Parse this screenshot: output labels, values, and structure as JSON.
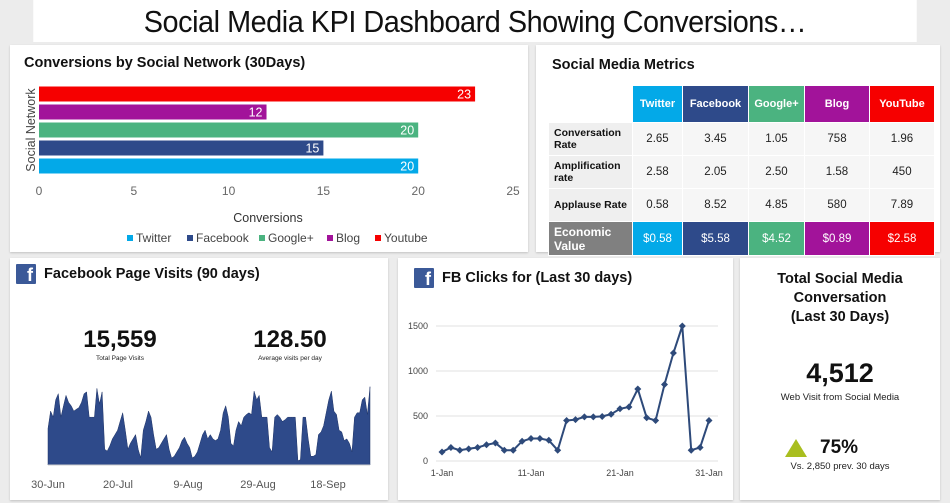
{
  "title": "Social Media KPI Dashboard Showing Conversions…",
  "colors": {
    "twitter": "#03a9e8",
    "facebook": "#2e4a8a",
    "google": "#4bb380",
    "blog": "#a2139a",
    "youtube": "#f60000",
    "fb_brand": "#3b5998",
    "area_fill": "#2e4a8a",
    "line": "#2e4a7a",
    "up_arrow": "#a9be1f",
    "econ_label": "#808080"
  },
  "conversions": {
    "title": "Conversions by Social Network (30Days)",
    "legend": [
      "Twitter",
      "Facebook",
      "Google+",
      "Blog",
      "Youtube"
    ]
  },
  "metrics": {
    "title": "Social Media Metrics",
    "columns": [
      "Twitter",
      "Facebook",
      "Google+",
      "Blog",
      "YouTube"
    ],
    "rows": [
      {
        "label": "Conversation Rate",
        "values": [
          "2.65",
          "3.45",
          "1.05",
          "758",
          "1.96"
        ]
      },
      {
        "label": "Amplification rate",
        "values": [
          "2.58",
          "2.05",
          "2.50",
          "1.58",
          "450"
        ]
      },
      {
        "label": "Applause Rate",
        "values": [
          "0.58",
          "8.52",
          "4.85",
          "580",
          "7.89"
        ]
      }
    ],
    "economic": {
      "label": "Economic Value",
      "values": [
        "$0.58",
        "$5.58",
        "$4.52",
        "$0.89",
        "$2.58"
      ]
    }
  },
  "fb_visits": {
    "icon": "f",
    "title": "Facebook Page Visits (90 days)",
    "total_value": "15,559",
    "total_label": "Total Page Visits",
    "avg_value": "128.50",
    "avg_label": "Average visits per day"
  },
  "fb_clicks": {
    "icon": "f",
    "title": "FB Clicks for (Last 30 days)"
  },
  "total": {
    "title_line1": "Total Social Media",
    "title_line2": "Conversation",
    "title_line3": "(Last 30 Days)",
    "value": "4,512",
    "value_label": "Web Visit from Social Media",
    "change": "75%",
    "change_label": "Vs. 2,850 prev. 30 days"
  },
  "chart_data": [
    {
      "type": "bar",
      "orientation": "horizontal",
      "title": "Conversions by Social Network (30Days)",
      "xlabel": "Conversions",
      "ylabel": "Social Network",
      "categories": [
        "Twitter",
        "Facebook",
        "Google+",
        "Blog",
        "Youtube"
      ],
      "values": [
        20,
        15,
        20,
        12,
        23
      ],
      "xlim": [
        0,
        25
      ],
      "xticks": [
        0,
        5,
        10,
        15,
        20,
        25
      ],
      "legend_position": "bottom",
      "data_labels": true
    },
    {
      "type": "area",
      "title": "Facebook Page Visits (90 days)",
      "xticks": [
        "30-Jun",
        "20-Jul",
        "9-Aug",
        "29-Aug",
        "18-Sep"
      ],
      "x_range_days": 92,
      "values": [
        42,
        62,
        55,
        75,
        82,
        55,
        68,
        80,
        72,
        68,
        62,
        64,
        66,
        72,
        82,
        84,
        55,
        55,
        55,
        88,
        70,
        84,
        18,
        16,
        22,
        30,
        35,
        40,
        50,
        60,
        40,
        18,
        25,
        30,
        35,
        18,
        8,
        40,
        50,
        62,
        55,
        35,
        18,
        20,
        25,
        30,
        35,
        18,
        8,
        10,
        15,
        20,
        28,
        32,
        25,
        20,
        8,
        10,
        15,
        25,
        35,
        40,
        30,
        35,
        30,
        28,
        30,
        40,
        60,
        68,
        55,
        25,
        22,
        40,
        50,
        45,
        55,
        58,
        60,
        58,
        85,
        75,
        80,
        55,
        55,
        55,
        20,
        15,
        55,
        58,
        55,
        50,
        52,
        55,
        55,
        55,
        55,
        5,
        6,
        55,
        55,
        30,
        10,
        10,
        12,
        35,
        38,
        45,
        60,
        75,
        85,
        62,
        58,
        40,
        38,
        28,
        30,
        25,
        15,
        55,
        60,
        60,
        75,
        78,
        58,
        90
      ],
      "ylim": [
        0,
        100
      ],
      "grid": false
    },
    {
      "type": "line",
      "title": "FB Clicks for (Last 30 days)",
      "xticks": [
        "1-Jan",
        "11-Jan",
        "21-Jan",
        "31-Jan"
      ],
      "x": [
        1,
        2,
        3,
        4,
        5,
        6,
        7,
        8,
        9,
        10,
        11,
        12,
        13,
        14,
        15,
        16,
        17,
        18,
        19,
        20,
        21,
        22,
        23,
        24,
        25,
        26,
        27,
        28,
        29,
        30,
        31
      ],
      "values": [
        100,
        150,
        120,
        135,
        150,
        180,
        200,
        120,
        120,
        220,
        250,
        250,
        230,
        120,
        450,
        460,
        490,
        490,
        495,
        520,
        580,
        600,
        800,
        480,
        450,
        850,
        1200,
        1500,
        120,
        150,
        450
      ],
      "ylim": [
        0,
        1500
      ],
      "yticks": [
        0,
        500,
        1000,
        1500
      ],
      "grid": true,
      "markers": "diamond"
    }
  ]
}
